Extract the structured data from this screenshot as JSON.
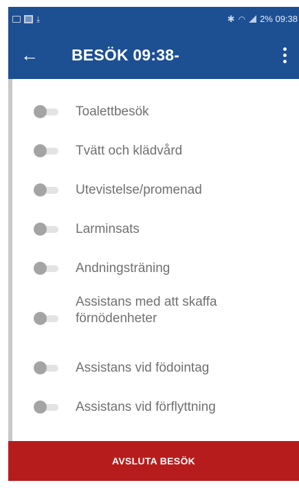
{
  "status_bar": {
    "right_text": "2% 09:38"
  },
  "app_bar": {
    "back_icon": "←",
    "title": "BESÖK 09:38-"
  },
  "list": {
    "items": [
      {
        "label": "Toalettbesök",
        "checked": false
      },
      {
        "label": "Tvätt och klädvård",
        "checked": false
      },
      {
        "label": "Utevistelse/promenad",
        "checked": false
      },
      {
        "label": "Larminsats",
        "checked": false
      },
      {
        "label": "Andningsträning",
        "checked": false
      },
      {
        "label": "Assistans med att skaffa förnödenheter",
        "checked": false
      },
      {
        "label": "Assistans vid födointag",
        "checked": false
      },
      {
        "label": "Assistans vid förflyttning",
        "checked": false
      }
    ]
  },
  "footer": {
    "finish_label": "AVSLUTA BESÖK"
  },
  "colors": {
    "primary": "#1d4f93",
    "finish": "#b71c1c"
  }
}
